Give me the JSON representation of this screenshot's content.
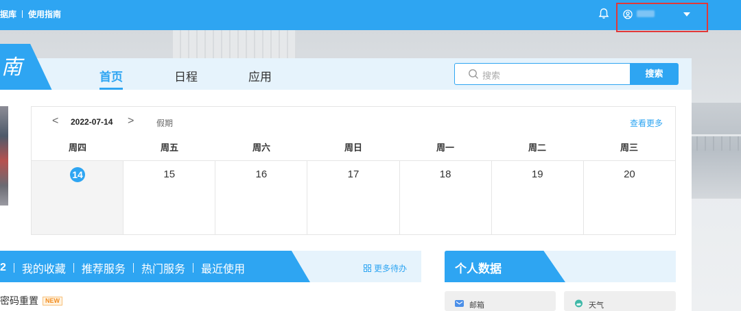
{
  "topbar": {
    "nav": [
      "据库",
      "使用指南"
    ],
    "user_name": "用户"
  },
  "logo": {
    "text": "南"
  },
  "nav": {
    "tabs": [
      {
        "label": "首页",
        "active": true
      },
      {
        "label": "日程",
        "active": false
      },
      {
        "label": "应用",
        "active": false
      }
    ]
  },
  "search": {
    "placeholder": "搜索",
    "button": "搜索"
  },
  "calendar": {
    "prev": "<",
    "next": ">",
    "date": "2022-07-14",
    "holiday": "假期",
    "more": "查看更多",
    "weekdays": [
      "周四",
      "周五",
      "周六",
      "周日",
      "周一",
      "周二",
      "周三"
    ],
    "days": [
      "14",
      "15",
      "16",
      "17",
      "18",
      "19",
      "20"
    ],
    "today": "14"
  },
  "services": {
    "tabs": [
      "2",
      "我的收藏",
      "推荐服务",
      "热门服务",
      "最近使用"
    ],
    "more": "更多待办",
    "items": [
      {
        "label": "密码重置",
        "badge": "NEW"
      }
    ]
  },
  "personal": {
    "title": "个人数据",
    "cards": [
      {
        "label": "邮箱",
        "icon": "mail-icon"
      },
      {
        "label": "天气",
        "icon": "weather-icon"
      }
    ]
  },
  "colors": {
    "accent": "#2ea5f2",
    "highlight_border": "#e23838"
  }
}
